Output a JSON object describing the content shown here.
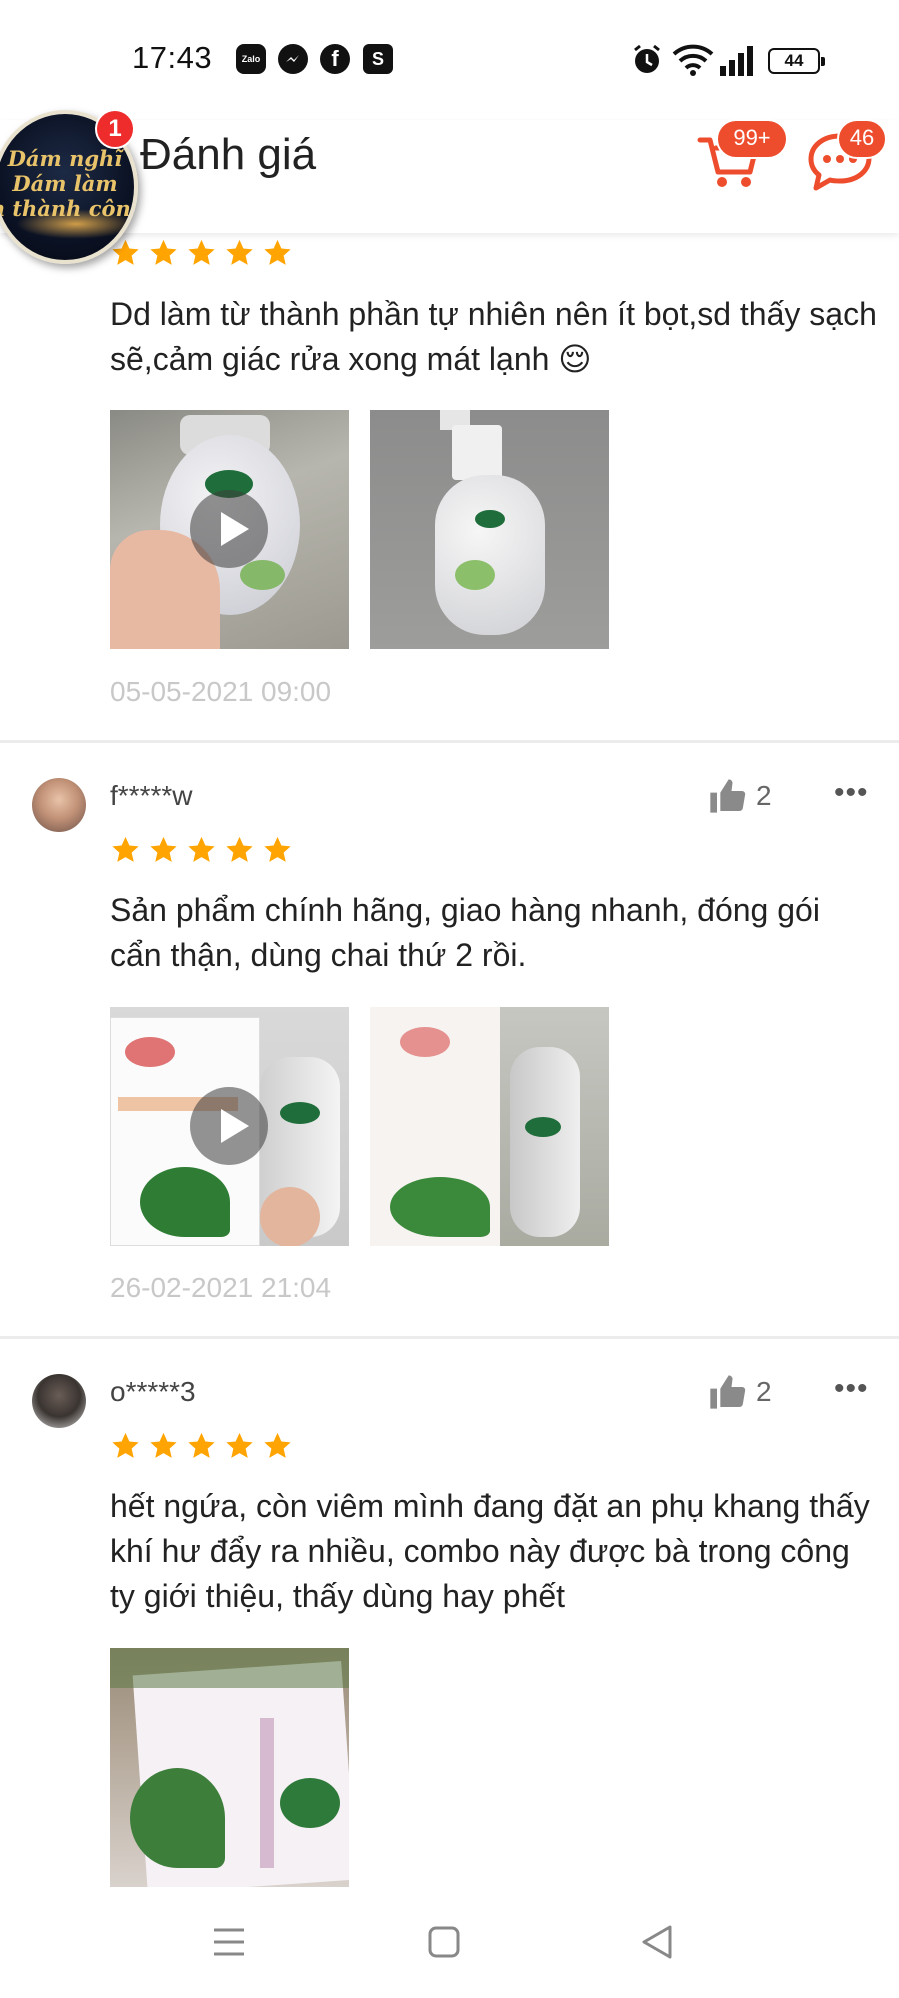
{
  "status_bar": {
    "time": "17:43",
    "apps": [
      "Zalo",
      "messenger-icon",
      "facebook-icon",
      "shopee-icon"
    ],
    "battery": "44"
  },
  "header": {
    "title": "Đánh giá",
    "cart_badge": "99+",
    "chat_badge": "46"
  },
  "promo": {
    "lines": [
      "Dám nghĩ",
      "Dám làm",
      "ám thành côn"
    ],
    "badge": "1"
  },
  "reviews": [
    {
      "rating": 5,
      "text": "Dd làm từ thành phần tự nhiên nên ít bọt,sd thấy sạch sẽ,cảm giác rửa xong mát lạnh 😌",
      "date": "05-05-2021 09:00"
    },
    {
      "username": "f*****w",
      "likes": "2",
      "rating": 5,
      "text": "Sản phẩm chính hãng, giao hàng nhanh, đóng gói cẩn thận, dùng chai thứ 2 rồi.",
      "date": "26-02-2021 21:04"
    },
    {
      "username": "o*****3",
      "likes": "2",
      "rating": 5,
      "text": "hết ngứa, còn viêm mình đang đặt an phụ khang thấy khí hư đẩy ra nhiều, combo này được bà trong công ty giới thiệu, thấy dùng hay phết"
    }
  ],
  "more_label": "•••",
  "colors": {
    "accent": "#ee4d2d",
    "star": "#ffa400",
    "date": "#c8c8c8"
  }
}
